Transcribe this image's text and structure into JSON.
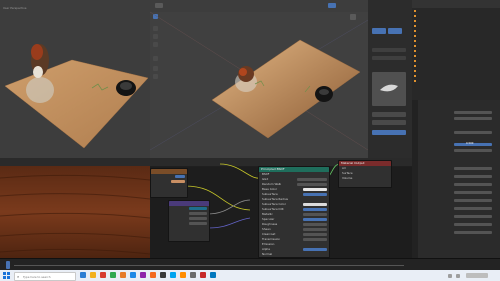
{
  "app": {
    "name": "Blender"
  },
  "viewport_left": {
    "label": "User Perspective"
  },
  "node_editor": {
    "principled": {
      "title": "Principled BSDF",
      "rows": [
        "BSDF",
        "GGX",
        "Random Walk",
        "Base Color",
        "Subsurface",
        "Subsurface Radius",
        "Subsurface Color",
        "Subsurface IOR",
        "Metallic",
        "Specular",
        "Roughness",
        "Sheen",
        "Clearcoat",
        "Transmission",
        "Emission",
        "Alpha",
        "Normal"
      ]
    },
    "output": {
      "title": "Material Output",
      "rows": [
        "All",
        "Surface",
        "Volume",
        "Displacement"
      ]
    }
  },
  "properties": {
    "selected_value": "0.500"
  },
  "taskbar": {
    "search_placeholder": "Type here to search"
  },
  "icons": [
    "cursor-icon",
    "move-icon",
    "rotate-icon",
    "scale-icon",
    "transform-icon",
    "annotate-icon",
    "measure-icon",
    "camera-icon",
    "light-icon",
    "search-icon",
    "windows-icon"
  ],
  "colors": {
    "accent": "#4772b3",
    "shader_header": "#1f6e5c",
    "texture_header": "#7a4d28",
    "vector_header": "#4a3a7a",
    "object_orange": "#e0922e"
  }
}
